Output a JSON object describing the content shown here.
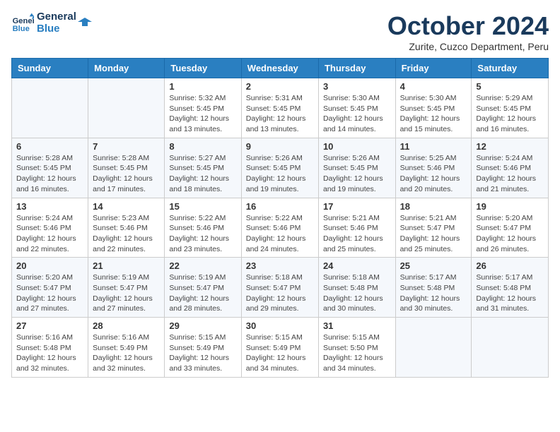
{
  "logo": {
    "line1": "General",
    "line2": "Blue"
  },
  "title": "October 2024",
  "subtitle": "Zurite, Cuzco Department, Peru",
  "weekdays": [
    "Sunday",
    "Monday",
    "Tuesday",
    "Wednesday",
    "Thursday",
    "Friday",
    "Saturday"
  ],
  "weeks": [
    [
      {
        "day": "",
        "info": ""
      },
      {
        "day": "",
        "info": ""
      },
      {
        "day": "1",
        "info": "Sunrise: 5:32 AM\nSunset: 5:45 PM\nDaylight: 12 hours and 13 minutes."
      },
      {
        "day": "2",
        "info": "Sunrise: 5:31 AM\nSunset: 5:45 PM\nDaylight: 12 hours and 13 minutes."
      },
      {
        "day": "3",
        "info": "Sunrise: 5:30 AM\nSunset: 5:45 PM\nDaylight: 12 hours and 14 minutes."
      },
      {
        "day": "4",
        "info": "Sunrise: 5:30 AM\nSunset: 5:45 PM\nDaylight: 12 hours and 15 minutes."
      },
      {
        "day": "5",
        "info": "Sunrise: 5:29 AM\nSunset: 5:45 PM\nDaylight: 12 hours and 16 minutes."
      }
    ],
    [
      {
        "day": "6",
        "info": "Sunrise: 5:28 AM\nSunset: 5:45 PM\nDaylight: 12 hours and 16 minutes."
      },
      {
        "day": "7",
        "info": "Sunrise: 5:28 AM\nSunset: 5:45 PM\nDaylight: 12 hours and 17 minutes."
      },
      {
        "day": "8",
        "info": "Sunrise: 5:27 AM\nSunset: 5:45 PM\nDaylight: 12 hours and 18 minutes."
      },
      {
        "day": "9",
        "info": "Sunrise: 5:26 AM\nSunset: 5:45 PM\nDaylight: 12 hours and 19 minutes."
      },
      {
        "day": "10",
        "info": "Sunrise: 5:26 AM\nSunset: 5:45 PM\nDaylight: 12 hours and 19 minutes."
      },
      {
        "day": "11",
        "info": "Sunrise: 5:25 AM\nSunset: 5:46 PM\nDaylight: 12 hours and 20 minutes."
      },
      {
        "day": "12",
        "info": "Sunrise: 5:24 AM\nSunset: 5:46 PM\nDaylight: 12 hours and 21 minutes."
      }
    ],
    [
      {
        "day": "13",
        "info": "Sunrise: 5:24 AM\nSunset: 5:46 PM\nDaylight: 12 hours and 22 minutes."
      },
      {
        "day": "14",
        "info": "Sunrise: 5:23 AM\nSunset: 5:46 PM\nDaylight: 12 hours and 22 minutes."
      },
      {
        "day": "15",
        "info": "Sunrise: 5:22 AM\nSunset: 5:46 PM\nDaylight: 12 hours and 23 minutes."
      },
      {
        "day": "16",
        "info": "Sunrise: 5:22 AM\nSunset: 5:46 PM\nDaylight: 12 hours and 24 minutes."
      },
      {
        "day": "17",
        "info": "Sunrise: 5:21 AM\nSunset: 5:46 PM\nDaylight: 12 hours and 25 minutes."
      },
      {
        "day": "18",
        "info": "Sunrise: 5:21 AM\nSunset: 5:47 PM\nDaylight: 12 hours and 25 minutes."
      },
      {
        "day": "19",
        "info": "Sunrise: 5:20 AM\nSunset: 5:47 PM\nDaylight: 12 hours and 26 minutes."
      }
    ],
    [
      {
        "day": "20",
        "info": "Sunrise: 5:20 AM\nSunset: 5:47 PM\nDaylight: 12 hours and 27 minutes."
      },
      {
        "day": "21",
        "info": "Sunrise: 5:19 AM\nSunset: 5:47 PM\nDaylight: 12 hours and 27 minutes."
      },
      {
        "day": "22",
        "info": "Sunrise: 5:19 AM\nSunset: 5:47 PM\nDaylight: 12 hours and 28 minutes."
      },
      {
        "day": "23",
        "info": "Sunrise: 5:18 AM\nSunset: 5:47 PM\nDaylight: 12 hours and 29 minutes."
      },
      {
        "day": "24",
        "info": "Sunrise: 5:18 AM\nSunset: 5:48 PM\nDaylight: 12 hours and 30 minutes."
      },
      {
        "day": "25",
        "info": "Sunrise: 5:17 AM\nSunset: 5:48 PM\nDaylight: 12 hours and 30 minutes."
      },
      {
        "day": "26",
        "info": "Sunrise: 5:17 AM\nSunset: 5:48 PM\nDaylight: 12 hours and 31 minutes."
      }
    ],
    [
      {
        "day": "27",
        "info": "Sunrise: 5:16 AM\nSunset: 5:48 PM\nDaylight: 12 hours and 32 minutes."
      },
      {
        "day": "28",
        "info": "Sunrise: 5:16 AM\nSunset: 5:49 PM\nDaylight: 12 hours and 32 minutes."
      },
      {
        "day": "29",
        "info": "Sunrise: 5:15 AM\nSunset: 5:49 PM\nDaylight: 12 hours and 33 minutes."
      },
      {
        "day": "30",
        "info": "Sunrise: 5:15 AM\nSunset: 5:49 PM\nDaylight: 12 hours and 34 minutes."
      },
      {
        "day": "31",
        "info": "Sunrise: 5:15 AM\nSunset: 5:50 PM\nDaylight: 12 hours and 34 minutes."
      },
      {
        "day": "",
        "info": ""
      },
      {
        "day": "",
        "info": ""
      }
    ]
  ]
}
